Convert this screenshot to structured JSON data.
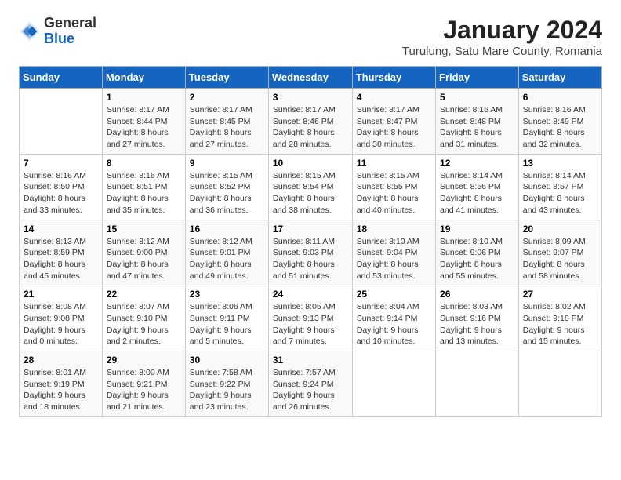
{
  "header": {
    "logo": {
      "general": "General",
      "blue": "Blue"
    },
    "month": "January 2024",
    "location": "Turulung, Satu Mare County, Romania"
  },
  "weekdays": [
    "Sunday",
    "Monday",
    "Tuesday",
    "Wednesday",
    "Thursday",
    "Friday",
    "Saturday"
  ],
  "weeks": [
    [
      {
        "day": "",
        "detail": ""
      },
      {
        "day": "1",
        "detail": "Sunrise: 8:17 AM\nSunset: 8:44 PM\nDaylight: 8 hours\nand 27 minutes."
      },
      {
        "day": "2",
        "detail": "Sunrise: 8:17 AM\nSunset: 8:45 PM\nDaylight: 8 hours\nand 27 minutes."
      },
      {
        "day": "3",
        "detail": "Sunrise: 8:17 AM\nSunset: 8:46 PM\nDaylight: 8 hours\nand 28 minutes."
      },
      {
        "day": "4",
        "detail": "Sunrise: 8:17 AM\nSunset: 8:47 PM\nDaylight: 8 hours\nand 30 minutes."
      },
      {
        "day": "5",
        "detail": "Sunrise: 8:16 AM\nSunset: 8:48 PM\nDaylight: 8 hours\nand 31 minutes."
      },
      {
        "day": "6",
        "detail": "Sunrise: 8:16 AM\nSunset: 8:49 PM\nDaylight: 8 hours\nand 32 minutes."
      }
    ],
    [
      {
        "day": "7",
        "detail": "Sunrise: 8:16 AM\nSunset: 8:50 PM\nDaylight: 8 hours\nand 33 minutes."
      },
      {
        "day": "8",
        "detail": "Sunrise: 8:16 AM\nSunset: 8:51 PM\nDaylight: 8 hours\nand 35 minutes."
      },
      {
        "day": "9",
        "detail": "Sunrise: 8:15 AM\nSunset: 8:52 PM\nDaylight: 8 hours\nand 36 minutes."
      },
      {
        "day": "10",
        "detail": "Sunrise: 8:15 AM\nSunset: 8:54 PM\nDaylight: 8 hours\nand 38 minutes."
      },
      {
        "day": "11",
        "detail": "Sunrise: 8:15 AM\nSunset: 8:55 PM\nDaylight: 8 hours\nand 40 minutes."
      },
      {
        "day": "12",
        "detail": "Sunrise: 8:14 AM\nSunset: 8:56 PM\nDaylight: 8 hours\nand 41 minutes."
      },
      {
        "day": "13",
        "detail": "Sunrise: 8:14 AM\nSunset: 8:57 PM\nDaylight: 8 hours\nand 43 minutes."
      }
    ],
    [
      {
        "day": "14",
        "detail": "Sunrise: 8:13 AM\nSunset: 8:59 PM\nDaylight: 8 hours\nand 45 minutes."
      },
      {
        "day": "15",
        "detail": "Sunrise: 8:12 AM\nSunset: 9:00 PM\nDaylight: 8 hours\nand 47 minutes."
      },
      {
        "day": "16",
        "detail": "Sunrise: 8:12 AM\nSunset: 9:01 PM\nDaylight: 8 hours\nand 49 minutes."
      },
      {
        "day": "17",
        "detail": "Sunrise: 8:11 AM\nSunset: 9:03 PM\nDaylight: 8 hours\nand 51 minutes."
      },
      {
        "day": "18",
        "detail": "Sunrise: 8:10 AM\nSunset: 9:04 PM\nDaylight: 8 hours\nand 53 minutes."
      },
      {
        "day": "19",
        "detail": "Sunrise: 8:10 AM\nSunset: 9:06 PM\nDaylight: 8 hours\nand 55 minutes."
      },
      {
        "day": "20",
        "detail": "Sunrise: 8:09 AM\nSunset: 9:07 PM\nDaylight: 8 hours\nand 58 minutes."
      }
    ],
    [
      {
        "day": "21",
        "detail": "Sunrise: 8:08 AM\nSunset: 9:08 PM\nDaylight: 9 hours\nand 0 minutes."
      },
      {
        "day": "22",
        "detail": "Sunrise: 8:07 AM\nSunset: 9:10 PM\nDaylight: 9 hours\nand 2 minutes."
      },
      {
        "day": "23",
        "detail": "Sunrise: 8:06 AM\nSunset: 9:11 PM\nDaylight: 9 hours\nand 5 minutes."
      },
      {
        "day": "24",
        "detail": "Sunrise: 8:05 AM\nSunset: 9:13 PM\nDaylight: 9 hours\nand 7 minutes."
      },
      {
        "day": "25",
        "detail": "Sunrise: 8:04 AM\nSunset: 9:14 PM\nDaylight: 9 hours\nand 10 minutes."
      },
      {
        "day": "26",
        "detail": "Sunrise: 8:03 AM\nSunset: 9:16 PM\nDaylight: 9 hours\nand 13 minutes."
      },
      {
        "day": "27",
        "detail": "Sunrise: 8:02 AM\nSunset: 9:18 PM\nDaylight: 9 hours\nand 15 minutes."
      }
    ],
    [
      {
        "day": "28",
        "detail": "Sunrise: 8:01 AM\nSunset: 9:19 PM\nDaylight: 9 hours\nand 18 minutes."
      },
      {
        "day": "29",
        "detail": "Sunrise: 8:00 AM\nSunset: 9:21 PM\nDaylight: 9 hours\nand 21 minutes."
      },
      {
        "day": "30",
        "detail": "Sunrise: 7:58 AM\nSunset: 9:22 PM\nDaylight: 9 hours\nand 23 minutes."
      },
      {
        "day": "31",
        "detail": "Sunrise: 7:57 AM\nSunset: 9:24 PM\nDaylight: 9 hours\nand 26 minutes."
      },
      {
        "day": "",
        "detail": ""
      },
      {
        "day": "",
        "detail": ""
      },
      {
        "day": "",
        "detail": ""
      }
    ]
  ]
}
